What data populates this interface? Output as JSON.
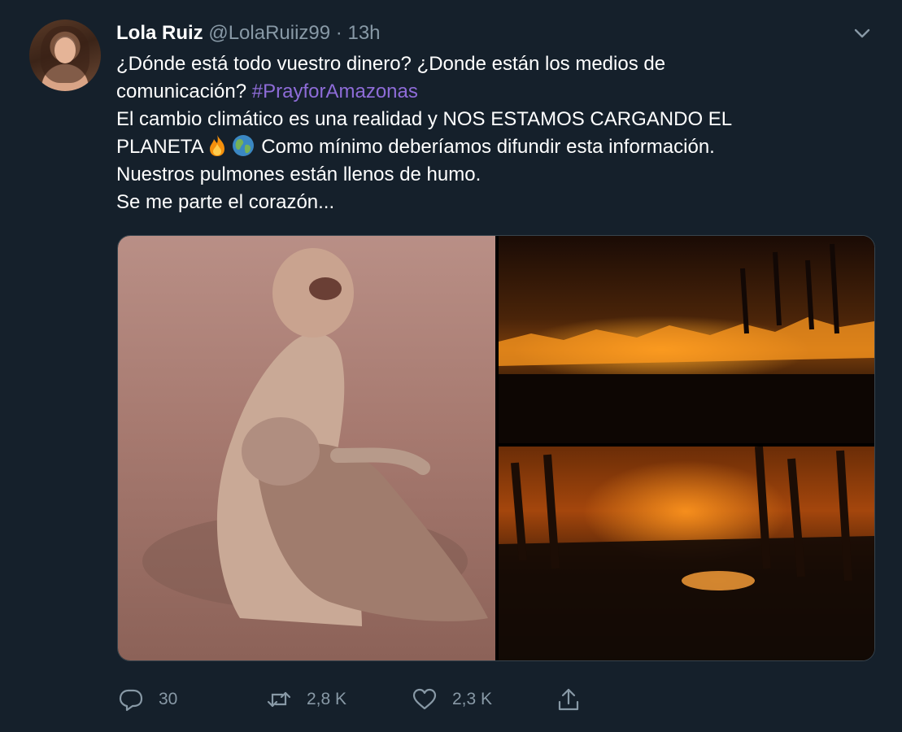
{
  "tweet": {
    "author_name": "Lola Ruiz",
    "handle": "@LolaRuiiz99",
    "separator": "·",
    "time": "13h",
    "lines": [
      "¿Dónde está todo vuestro dinero? ¿Donde están los medios de",
      "comunicación?",
      "El cambio climático es una realidad y NOS ESTAMOS CARGANDO EL",
      "PLANETA",
      "Como mínimo deberíamos difundir esta información.",
      "Nuestros pulmones están llenos de humo.",
      "Se me parte el corazón..."
    ],
    "hashtag": "#PrayforAmazonas",
    "emojis": [
      "fire-emoji",
      "globe-emoji"
    ],
    "images": [
      {
        "name": "monkey-photo"
      },
      {
        "name": "forest-fire-photo-top"
      },
      {
        "name": "forest-fire-photo-bottom"
      }
    ]
  },
  "actions": {
    "reply_count": "30",
    "retweet_count": "2,8 K",
    "like_count": "2,3 K",
    "icons": [
      "reply-icon",
      "retweet-icon",
      "like-icon",
      "share-icon"
    ]
  },
  "colors": {
    "background": "#15202b",
    "text": "#ffffff",
    "secondary": "#8899a6",
    "hashtag": "#8e6cd8"
  }
}
